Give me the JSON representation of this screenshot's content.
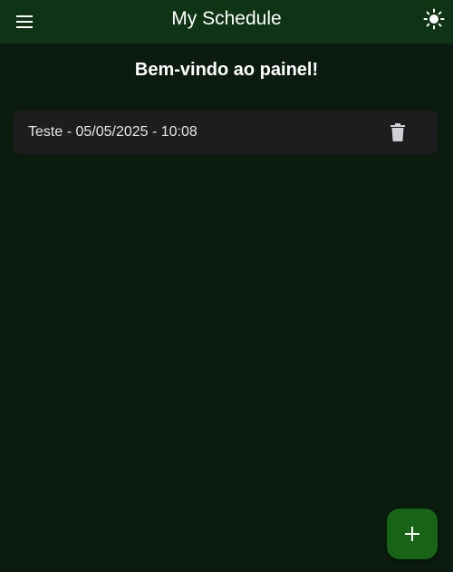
{
  "appbar": {
    "title": "My Schedule",
    "menu_icon": "menu-icon",
    "theme_icon": "sun-icon"
  },
  "main": {
    "welcome": "Bem-vindo ao painel!",
    "schedules": [
      {
        "text": "Teste - 05/05/2025 - 10:08",
        "action_icon": "trash-icon"
      }
    ]
  },
  "fab": {
    "icon": "plus-icon"
  },
  "colors": {
    "background": "#0b1b10",
    "appbar": "#0f3315",
    "card": "#1d1d20",
    "fab": "#186416",
    "text": "#ffffff"
  }
}
